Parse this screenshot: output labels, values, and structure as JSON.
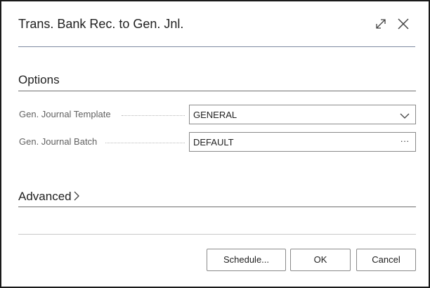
{
  "dialog": {
    "title": "Trans. Bank Rec. to Gen. Jnl.",
    "icons": {
      "expand": "expand-icon",
      "close": "close-icon"
    }
  },
  "options": {
    "title": "Options",
    "fields": [
      {
        "label": "Gen. Journal Template",
        "value": "GENERAL",
        "control": "dropdown"
      },
      {
        "label": "Gen. Journal Batch",
        "value": "DEFAULT",
        "control": "lookup",
        "suffix": "···"
      }
    ]
  },
  "advanced": {
    "title": "Advanced"
  },
  "buttons": {
    "schedule": "Schedule...",
    "ok": "OK",
    "cancel": "Cancel"
  },
  "colors": {
    "border": "#1a1a1a",
    "header_line": "#7d8aa0",
    "label": "#616161",
    "text": "#212121"
  }
}
